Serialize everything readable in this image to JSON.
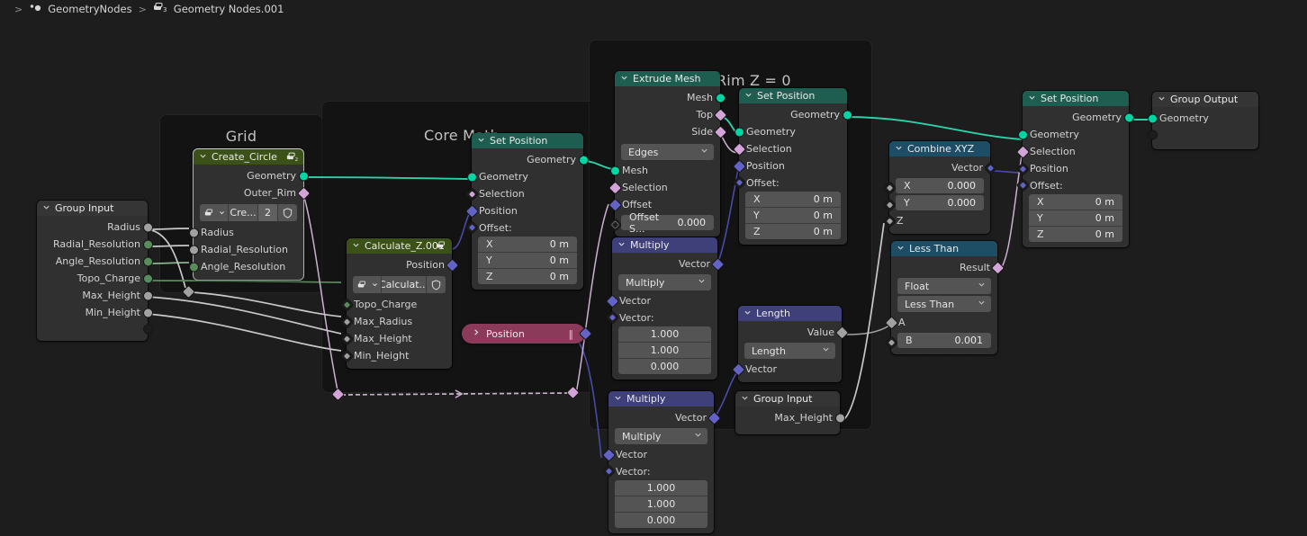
{
  "breadcrumb": {
    "items": [
      {
        "icon": "nodetree-icon",
        "label": "GeometryNodes"
      },
      {
        "icon": "modifier-icon",
        "label": "Geometry Nodes.001"
      }
    ],
    "separator": ">"
  },
  "frames": [
    {
      "name": "grid-frame",
      "label": "Grid"
    },
    {
      "name": "core-math-frame",
      "label": "Core Math"
    },
    {
      "name": "outer-rim-frame",
      "label": "Outer Rim Z = 0"
    }
  ],
  "nodes": {
    "group_input_main": {
      "title": "Group Input",
      "outputs": [
        "Radius",
        "Radial_Resolution",
        "Angle_Resolution",
        "Topo_Charge",
        "Max_Height",
        "Min_Height",
        ""
      ]
    },
    "create_circle": {
      "title": "Create_Circle",
      "outputs": [
        "Geometry",
        "Outer_Rim"
      ],
      "datablock": {
        "name": "Cre...",
        "users": "2",
        "shield": "shield-icon"
      },
      "inputs": [
        "Radius",
        "Radial_Resolution",
        "Angle_Resolution"
      ]
    },
    "calculate_z": {
      "title": "Calculate_Z.001",
      "outputs": [
        "Position"
      ],
      "datablock": {
        "name": "Calculat...",
        "shield": "shield-icon"
      },
      "inputs": [
        "Topo_Charge",
        "Max_Radius",
        "Max_Height",
        "Min_Height"
      ]
    },
    "set_position_core": {
      "title": "Set Position",
      "outputs": [
        "Geometry"
      ],
      "inputs": [
        "Geometry",
        "Selection",
        "Position",
        "Offset:"
      ],
      "offset": [
        {
          "axis": "X",
          "value": "0 m"
        },
        {
          "axis": "Y",
          "value": "0 m"
        },
        {
          "axis": "Z",
          "value": "0 m"
        }
      ]
    },
    "position_collapsed": {
      "title": "Position",
      "dots": "‖"
    },
    "extrude_mesh": {
      "title": "Extrude Mesh",
      "outputs": [
        "Mesh",
        "Top",
        "Side"
      ],
      "mode": "Edges",
      "inputs": [
        "Mesh",
        "Selection",
        "Offset"
      ],
      "offset_scale": {
        "label": "Offset S...",
        "value": "0.000"
      }
    },
    "multiply_top": {
      "title": "Multiply",
      "outputs": [
        "Vector"
      ],
      "operation": "Multiply",
      "inputs": [
        "Vector",
        "Vector:"
      ],
      "values": [
        "1.000",
        "1.000",
        "0.000"
      ]
    },
    "multiply_bottom": {
      "title": "Multiply",
      "outputs": [
        "Vector"
      ],
      "operation": "Multiply",
      "inputs": [
        "Vector",
        "Vector:"
      ],
      "values": [
        "1.000",
        "1.000",
        "0.000"
      ]
    },
    "set_position_mid": {
      "title": "Set Position",
      "outputs": [
        "Geometry"
      ],
      "inputs": [
        "Geometry",
        "Selection",
        "Position",
        "Offset:"
      ],
      "offset": [
        {
          "axis": "X",
          "value": "0 m"
        },
        {
          "axis": "Y",
          "value": "0 m"
        },
        {
          "axis": "Z",
          "value": "0 m"
        }
      ]
    },
    "length": {
      "title": "Length",
      "outputs": [
        "Value"
      ],
      "operation": "Length",
      "inputs": [
        "Vector"
      ]
    },
    "group_input_max_height": {
      "title": "Group Input",
      "outputs": [
        "Max_Height"
      ]
    },
    "combine_xyz": {
      "title": "Combine XYZ",
      "outputs": [
        "Vector"
      ],
      "fields": [
        {
          "axis": "X",
          "value": "0.000"
        },
        {
          "axis": "Y",
          "value": "0.000"
        }
      ],
      "inputs": [
        "Z"
      ]
    },
    "less_than": {
      "title": "Less Than",
      "outputs": [
        "Result"
      ],
      "data_type": "Float",
      "operation": "Less Than",
      "inputs": [
        "A"
      ],
      "b_field": {
        "label": "B",
        "value": "0.001"
      }
    },
    "set_position_right": {
      "title": "Set Position",
      "outputs": [
        "Geometry"
      ],
      "inputs": [
        "Geometry",
        "Selection",
        "Position",
        "Offset:"
      ],
      "offset": [
        {
          "axis": "X",
          "value": "0 m"
        },
        {
          "axis": "Y",
          "value": "0 m"
        },
        {
          "axis": "Z",
          "value": "0 m"
        }
      ]
    },
    "group_output": {
      "title": "Group Output",
      "inputs": [
        "Geometry",
        ""
      ]
    }
  },
  "colors": {
    "geometry_socket": "#00d6a3",
    "vector_socket": "#6363c7",
    "field_socket": "#d4a4d8",
    "float_socket": "#a1a1a1",
    "int_socket": "#598c5c",
    "header_geometry": "#1d5e50",
    "header_group": "#3c5117",
    "header_vector": "#3f3f79",
    "header_converter": "#1e4d66",
    "collapsed_node": "#8c3a5a",
    "canvas_background": "#1d1d1d",
    "node_background": "#303030"
  },
  "icons": {
    "chevron_down": "⌄",
    "chevron_right": "›",
    "dropdown_arrow": "⌄"
  }
}
